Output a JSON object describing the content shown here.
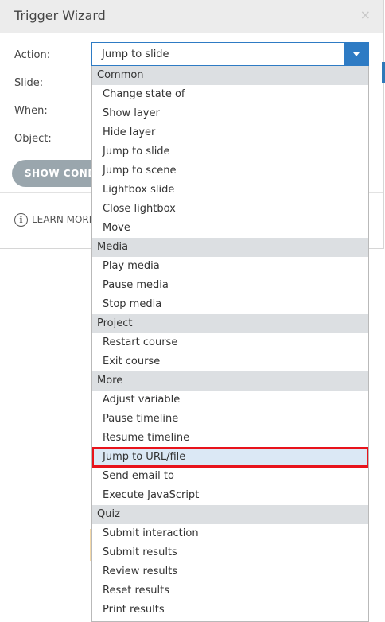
{
  "dialog": {
    "title": "Trigger Wizard",
    "close": "×",
    "labels": {
      "action": "Action:",
      "slide": "Slide:",
      "when": "When:",
      "object": "Object:"
    },
    "show_conditions": "SHOW CONDITIONS",
    "learn_more": "LEARN MORE"
  },
  "action_select": {
    "value": "Jump to slide"
  },
  "dropdown": {
    "groups": [
      {
        "name": "Common",
        "items": [
          "Change state of",
          "Show layer",
          "Hide layer",
          "Jump to slide",
          "Jump to scene",
          "Lightbox slide",
          "Close lightbox",
          "Move"
        ]
      },
      {
        "name": "Media",
        "items": [
          "Play media",
          "Pause media",
          "Stop media"
        ]
      },
      {
        "name": "Project",
        "items": [
          "Restart course",
          "Exit course"
        ]
      },
      {
        "name": "More",
        "items": [
          "Adjust variable",
          "Pause timeline",
          "Resume timeline",
          "Jump to URL/file",
          "Send email to",
          "Execute JavaScript"
        ]
      },
      {
        "name": "Quiz",
        "items": [
          "Submit interaction",
          "Submit results",
          "Review results",
          "Reset results",
          "Print results"
        ]
      }
    ],
    "highlighted": "Jump to URL/file"
  },
  "colors": {
    "accent": "#2e7bc4",
    "highlight_border": "#e8131b",
    "group_bg": "#dcdfe2"
  }
}
